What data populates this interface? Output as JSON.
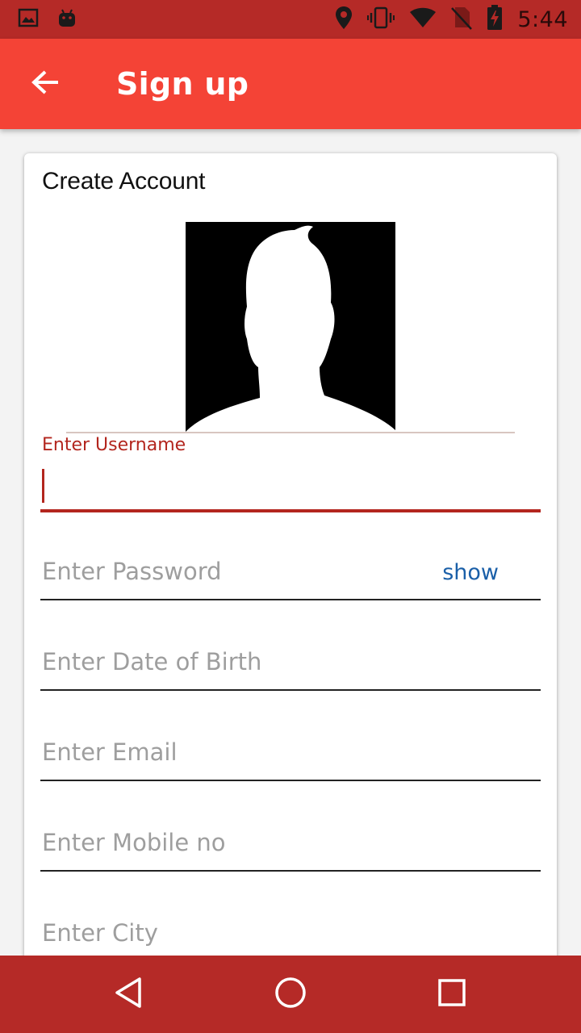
{
  "status_bar": {
    "time": "5:44",
    "left_icons": [
      "gallery-icon",
      "android-debug-icon"
    ],
    "right_icons": [
      "location-icon",
      "vibrate-icon",
      "wifi-icon",
      "no-sim-icon",
      "battery-charging-icon"
    ]
  },
  "app_bar": {
    "title": "Sign up",
    "back_icon": "arrow-left-icon",
    "color": "#f44336"
  },
  "form": {
    "heading": "Create Account",
    "avatar_icon": "default-profile-silhouette",
    "username": {
      "label": "Enter Username",
      "value": ""
    },
    "password": {
      "placeholder": "Enter Password",
      "toggle_label": "show"
    },
    "dob": {
      "placeholder": "Enter Date of Birth"
    },
    "email": {
      "placeholder": "Enter Email"
    },
    "mobile": {
      "placeholder": "Enter Mobile no"
    },
    "city": {
      "placeholder": "Enter City"
    }
  },
  "nav_bar": {
    "buttons": [
      "back-triangle-icon",
      "home-circle-icon",
      "recents-square-icon"
    ]
  },
  "colors": {
    "status_bar": "#b52a27",
    "app_bar": "#f44336",
    "accent": "#b3261e",
    "link": "#1a5fa8",
    "nav_bar": "#b52a27"
  }
}
